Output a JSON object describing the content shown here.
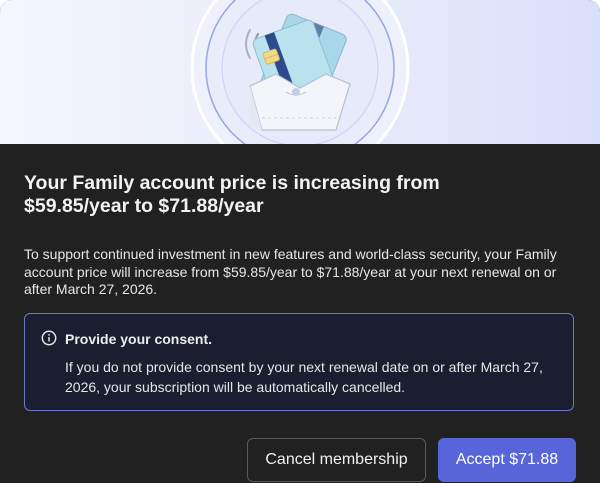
{
  "dialog": {
    "title": "Your Family account price is increasing from $59.85/year to $71.88/year",
    "description": "To support continued investment in new features and world-class security, your Family account price will increase from $59.85/year to $71.88/year at your next renewal on or after March 27, 2026.",
    "notice": {
      "icon": "info-icon",
      "title": "Provide your consent.",
      "text": "If you do not provide consent by your next renewal date on or after March 27, 2026, your subscription will be automatically cancelled."
    },
    "buttons": {
      "cancel_label": "Cancel membership",
      "accept_label": "Accept $71.88"
    },
    "illustration": "credit-card-wallet-icon",
    "colors": {
      "accent": "#5865d8",
      "notice_border": "#6e74c8",
      "notice_background": "#1b1d30",
      "dialog_background": "#212121"
    }
  }
}
